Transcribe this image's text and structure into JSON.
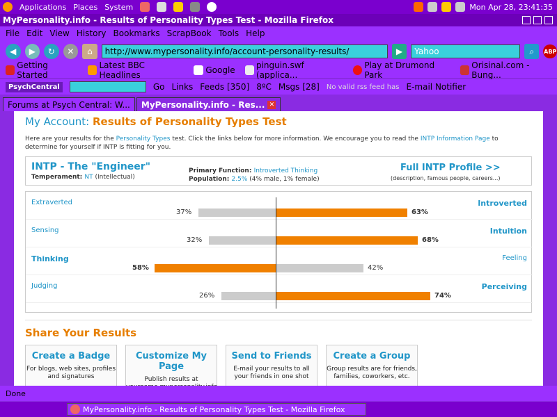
{
  "system": {
    "applications": "Applications",
    "places": "Places",
    "system": "System",
    "datetime": "Mon Apr 28, 23:41:35"
  },
  "window": {
    "title": "MyPersonality.info - Results of Personality Types Test - Mozilla Firefox"
  },
  "menu": {
    "items": [
      "File",
      "Edit",
      "View",
      "History",
      "Bookmarks",
      "ScrapBook",
      "Tools",
      "Help"
    ]
  },
  "nav": {
    "url": "http://www.mypersonality.info/account-personality-results/",
    "search_value": "Yahoo",
    "abp": "ABP"
  },
  "bookmarks": {
    "items": [
      "Getting Started",
      "Latest BBC Headlines",
      "Google",
      "pinguin.swf (applica...",
      "Play at Drumond Park",
      "Orisinal.com - Bung..."
    ]
  },
  "toolbar2": {
    "brand": "PsychCentral",
    "go": "Go",
    "links": "Links",
    "feeds": "Feeds [350]",
    "weather": "8ºC",
    "msgs": "Msgs [28]",
    "rss": "No valid rss feed has",
    "email": "E-mail Notifier"
  },
  "tabs": [
    {
      "label": "Forums at Psych Central: W..."
    },
    {
      "label": "MyPersonality.info - Res..."
    }
  ],
  "page": {
    "heading_prefix": "My Account: ",
    "heading_main": "Results of Personality Types Test",
    "intro_1": "Here are your results for the ",
    "intro_link1": "Personality Types",
    "intro_2": " test. Click the links below for more information. We encourage you to read the ",
    "intro_link2": "INTP Information Page",
    "intro_3": " to determine for yourself if INTP is fitting for you.",
    "type_code": "INTP",
    "type_name": " - The \"Engineer\"",
    "temperament_label": "Temperament: ",
    "temperament_value": "NT",
    "temperament_desc": " (Intellectual)",
    "primary_label": "Primary Function: ",
    "primary_value": "Introverted Thinking",
    "population_label": "Population: ",
    "population_value": "2.5%",
    "population_desc": " (4% male, 1% female)",
    "full_profile": "Full INTP Profile >>",
    "full_profile_sub": "(description, famous people, careers...)",
    "share_title": "Share Your Results"
  },
  "dimensions": [
    {
      "left": "Extraverted",
      "right": "Introverted",
      "left_pct": 37,
      "right_pct": 63,
      "left_label": "37%",
      "right_label": "63%",
      "dominant": "right"
    },
    {
      "left": "Sensing",
      "right": "Intuition",
      "left_pct": 32,
      "right_pct": 68,
      "left_label": "32%",
      "right_label": "68%",
      "dominant": "right"
    },
    {
      "left": "Thinking",
      "right": "Feeling",
      "left_pct": 58,
      "right_pct": 42,
      "left_label": "58%",
      "right_label": "42%",
      "dominant": "left"
    },
    {
      "left": "Judging",
      "right": "Perceiving",
      "left_pct": 26,
      "right_pct": 74,
      "left_label": "26%",
      "right_label": "74%",
      "dominant": "right"
    }
  ],
  "cards": [
    {
      "title": "Create a Badge",
      "sub": "For blogs, web sites, profiles and signatures"
    },
    {
      "title": "Customize My Page",
      "sub": "Publish results at yourname.mypersonality.info"
    },
    {
      "title": "Send to Friends",
      "sub": "E-mail your results to all your friends in one shot"
    },
    {
      "title": "Create a Group",
      "sub": "Group results are for friends, families, coworkers, etc."
    }
  ],
  "status": {
    "text": "Done"
  },
  "taskbar": {
    "item": "MyPersonality.info - Results of Personality Types Test - Mozilla Firefox"
  },
  "colors": {
    "accent": "#e67e00",
    "link": "#2196c8",
    "chrome": "#9b30ff"
  }
}
